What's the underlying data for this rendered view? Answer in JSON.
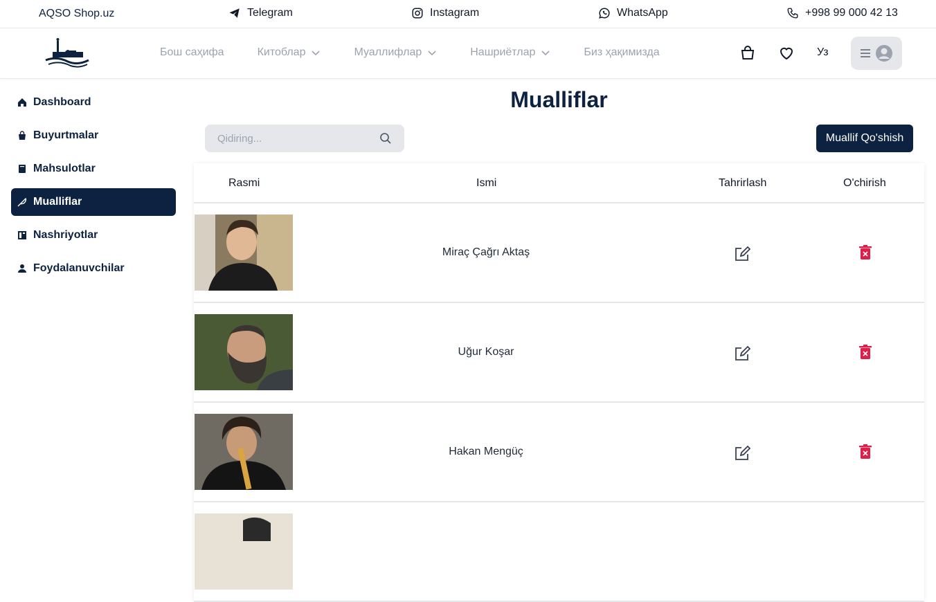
{
  "topbar": {
    "brand": "AQSO Shop.uz",
    "contacts": [
      {
        "icon": "telegram-icon",
        "label": "Telegram"
      },
      {
        "icon": "instagram-icon",
        "label": "Instagram"
      },
      {
        "icon": "whatsapp-icon",
        "label": "WhatsApp"
      },
      {
        "icon": "phone-icon",
        "label": "+998 99 000 42 13"
      }
    ]
  },
  "header": {
    "nav": [
      {
        "label": "Бош саҳифа",
        "dropdown": false
      },
      {
        "label": "Китоблар",
        "dropdown": true
      },
      {
        "label": "Муаллифлар",
        "dropdown": true
      },
      {
        "label": "Нашриётлар",
        "dropdown": true
      },
      {
        "label": "Биз ҳақимизда",
        "dropdown": false
      }
    ],
    "lang": "Уз"
  },
  "sidebar": {
    "items": [
      {
        "label": "Dashboard",
        "icon": "home-icon",
        "active": false
      },
      {
        "label": "Buyurtmalar",
        "icon": "bag-icon",
        "active": false
      },
      {
        "label": "Mahsulotlar",
        "icon": "book-icon",
        "active": false
      },
      {
        "label": "Mualliflar",
        "icon": "feather-icon",
        "active": true
      },
      {
        "label": "Nashriyotlar",
        "icon": "publisher-icon",
        "active": false
      },
      {
        "label": "Foydalanuvchilar",
        "icon": "user-icon",
        "active": false
      }
    ]
  },
  "main": {
    "title": "Mualliflar",
    "search_placeholder": "Qidiring...",
    "add_button": "Muallif Qo'shish",
    "columns": [
      "Rasmi",
      "Ismi",
      "Tahrirlash",
      "O'chirish"
    ],
    "rows": [
      {
        "name": "Miraç Çağrı Aktaş"
      },
      {
        "name": "Uğur Koşar"
      },
      {
        "name": "Hakan Mengüç"
      },
      {
        "name": ""
      }
    ]
  },
  "colors": {
    "primary": "#0d2240",
    "danger": "#e11d48",
    "muted": "#9ca3af"
  }
}
